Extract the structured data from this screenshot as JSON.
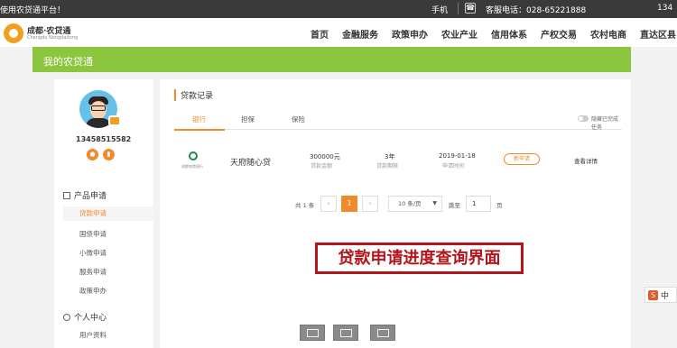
{
  "topbar": {
    "welcome": "使用农贷通平台！",
    "phone_label": "手机",
    "hotline": "客服电话：028-65221888",
    "user": "134"
  },
  "logo": {
    "title": "成都·农贷通",
    "subtitle": "Chengdu Nongdaitong"
  },
  "nav": [
    "首页",
    "金融服务",
    "政策申办",
    "农业产业",
    "信用体系",
    "产权交易",
    "农村电商",
    "直达区县"
  ],
  "banner": {
    "title": "我的农贷通"
  },
  "profile": {
    "phone": "13458515582"
  },
  "sidebar": {
    "group1": "产品申请",
    "items": [
      "贷款申请",
      "国债申请",
      "小微申请",
      "服务申请",
      "政策申办"
    ],
    "group2": "个人中心",
    "items2": [
      "用户资料"
    ]
  },
  "panel": {
    "title": "贷款记录",
    "tabs": [
      "银行",
      "担保",
      "保险"
    ],
    "toggle_label": "隐藏已完成任务"
  },
  "record": {
    "bank_name": "成都农商银行",
    "product": "天府随心贷",
    "amount": "300000元",
    "amount_label": "贷款金额",
    "term": "3年",
    "term_label": "贷款期限",
    "date": "2019-01-18",
    "date_label": "申请时间",
    "status": "新申请",
    "detail": "查看详情"
  },
  "pager": {
    "total": "共 1 条",
    "prev": "‹",
    "page": "1",
    "next": "›",
    "page_size": "10 条/页",
    "goto": "跳至",
    "goto_value": "1",
    "page_unit": "页"
  },
  "caption": "贷款申请进度查询界面",
  "ime": {
    "letter": "S",
    "lang": "中"
  },
  "colors": {
    "accent": "#f08a2a",
    "banner": "#8cc63f",
    "caption": "#b4141a"
  }
}
